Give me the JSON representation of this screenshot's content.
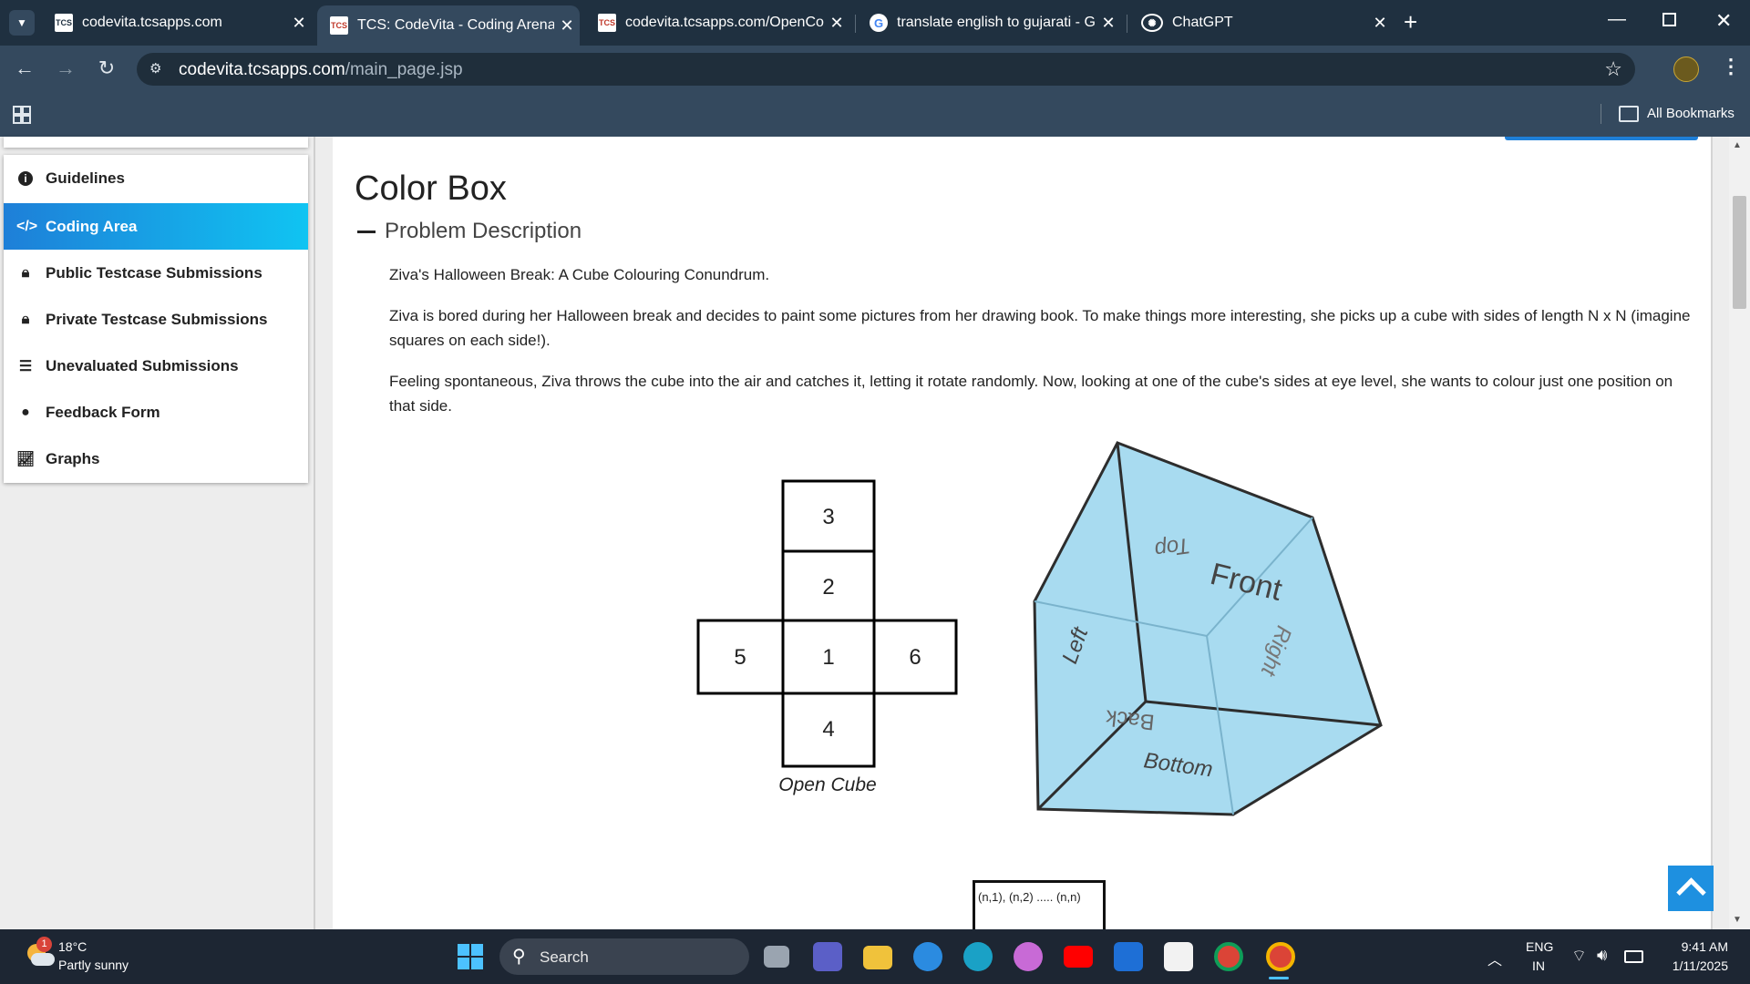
{
  "tabs": [
    {
      "title": "codevita.tcsapps.com",
      "favicon": "tcs-icon"
    },
    {
      "title": "TCS: CodeVita - Coding Arena",
      "favicon": "tcs-icon",
      "active": true
    },
    {
      "title": "codevita.tcsapps.com/OpenCod",
      "favicon": "tcs-icon"
    },
    {
      "title": "translate english to gujarati - Gc",
      "favicon": "google-icon"
    },
    {
      "title": "ChatGPT",
      "favicon": "chatgpt-icon"
    }
  ],
  "address": {
    "domain": "codevita.tcsapps.com",
    "path": "/main_page.jsp"
  },
  "bookmarks": {
    "label": "All Bookmarks"
  },
  "sidebar": {
    "items": [
      {
        "label": "Guidelines",
        "icon": "info-icon"
      },
      {
        "label": "Coding Area",
        "icon": "code-icon",
        "active": true
      },
      {
        "label": "Public Testcase Submissions",
        "icon": "lock-icon"
      },
      {
        "label": "Private Testcase Submissions",
        "icon": "lock-icon"
      },
      {
        "label": "Unevaluated Submissions",
        "icon": "list-icon"
      },
      {
        "label": "Feedback Form",
        "icon": "chat-icon"
      },
      {
        "label": "Graphs",
        "icon": "chart-icon"
      }
    ]
  },
  "problem": {
    "title": "Color Box",
    "section": "Problem Description",
    "paragraphs": [
      "Ziva's Halloween Break: A Cube Colouring Conundrum.",
      "Ziva is bored during her Halloween break and decides to paint some pictures from her drawing book. To make things more interesting, she picks up a cube with sides of length N x N (imagine squares on each side!).",
      "Feeling spontaneous, Ziva throws the cube into the air and catches it, letting it rotate randomly. Now, looking at one of the cube's sides at eye level, she wants to colour just one position on that side."
    ],
    "open_cube": {
      "cells": [
        "3",
        "2",
        "5",
        "1",
        "6",
        "4"
      ],
      "caption": "Open Cube"
    },
    "cube_faces": [
      "Top",
      "Front",
      "Left",
      "Right",
      "Back",
      "Bottom"
    ],
    "grid_label": "(n,1), (n,2) ..... (n,n)"
  },
  "taskbar": {
    "weather_temp": "18°C",
    "weather_desc": "Partly sunny",
    "weather_badge": "1",
    "search_label": "Search",
    "lang_top": "ENG",
    "lang_bottom": "IN",
    "time": "9:41 AM",
    "date": "1/11/2025"
  }
}
